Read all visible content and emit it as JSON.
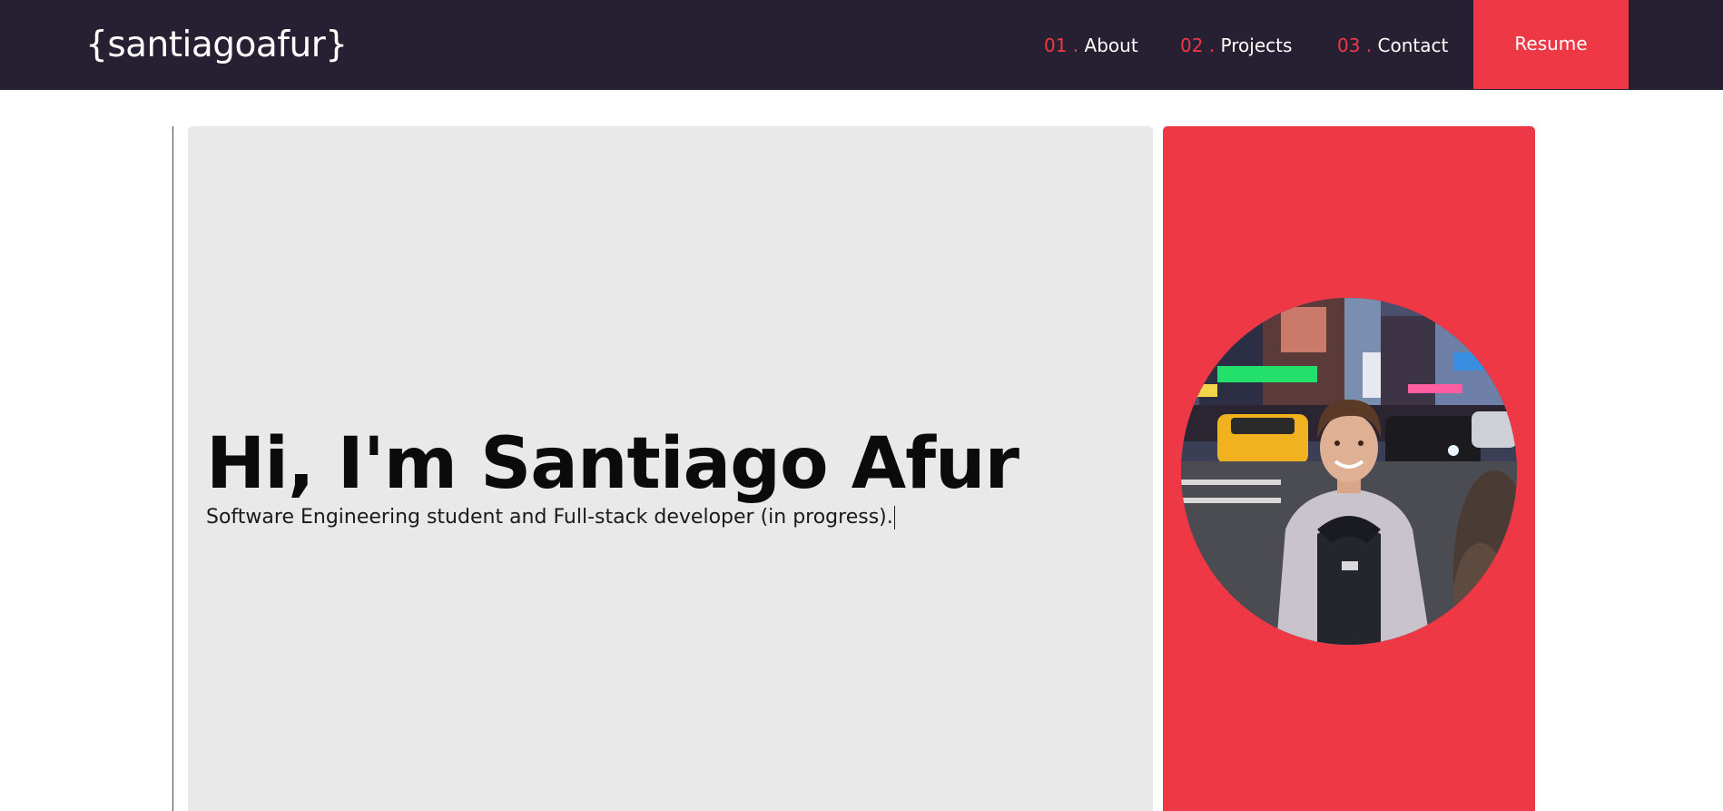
{
  "header": {
    "logo": "{santiagoafur}",
    "nav": [
      {
        "num": "01 .",
        "label": "About"
      },
      {
        "num": "02 .",
        "label": "Projects"
      },
      {
        "num": "03 .",
        "label": "Contact"
      }
    ],
    "resume_label": "Resume"
  },
  "hero": {
    "title": "Hi, I'm Santiago Afur",
    "subtitle": "Software Engineering student and Full-stack developer (in progress)."
  },
  "colors": {
    "nav_background": "#272032",
    "accent": "#ef3846",
    "hero_panel": "#e9e9e9"
  }
}
